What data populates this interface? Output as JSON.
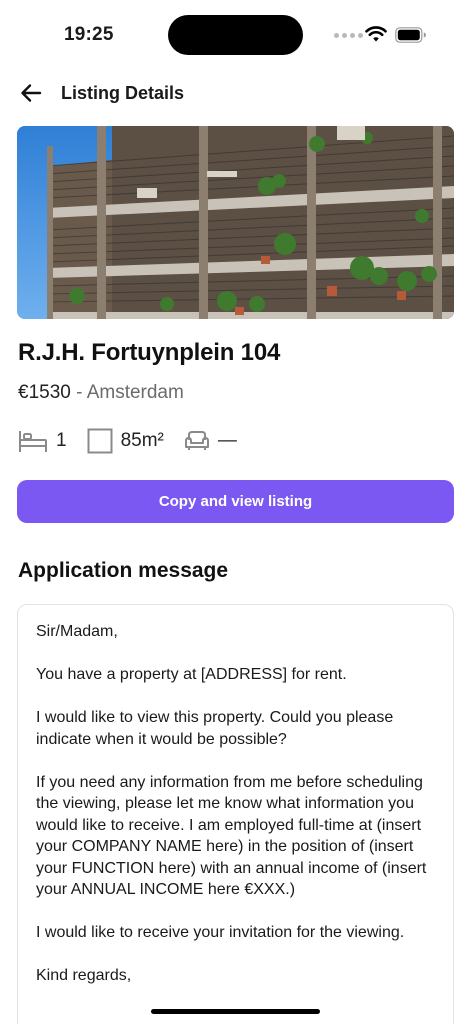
{
  "status_bar": {
    "time": "19:25"
  },
  "nav": {
    "title": "Listing Details",
    "back_icon": "arrow-left-icon"
  },
  "listing": {
    "title": "R.J.H. Fortuynplein 104",
    "price": "€1530",
    "separator": " - ",
    "city": "Amsterdam",
    "features": {
      "bedrooms": "1",
      "area": "85m²",
      "furnished": "—"
    }
  },
  "actions": {
    "copy_view_label": "Copy and view listing"
  },
  "application": {
    "section_title": "Application message",
    "paragraphs": [
      "Sir/Madam,",
      "You have a property at [ADDRESS] for rent.",
      "I would like to view this property. Could you please indicate when it would be possible?",
      "If you need any information from me before scheduling the viewing, please let me know what information you would like to receive. I am employed full-time at (insert your COMPANY NAME here) in the position of (insert your FUNCTION here) with an annual income of (insert your ANNUAL INCOME here €XXX.)",
      "I would like to receive your invitation for the viewing.",
      "Kind regards,"
    ]
  },
  "colors": {
    "accent": "#7b58f2",
    "muted_text": "#6b6b6b",
    "border": "#e3e3e3"
  }
}
